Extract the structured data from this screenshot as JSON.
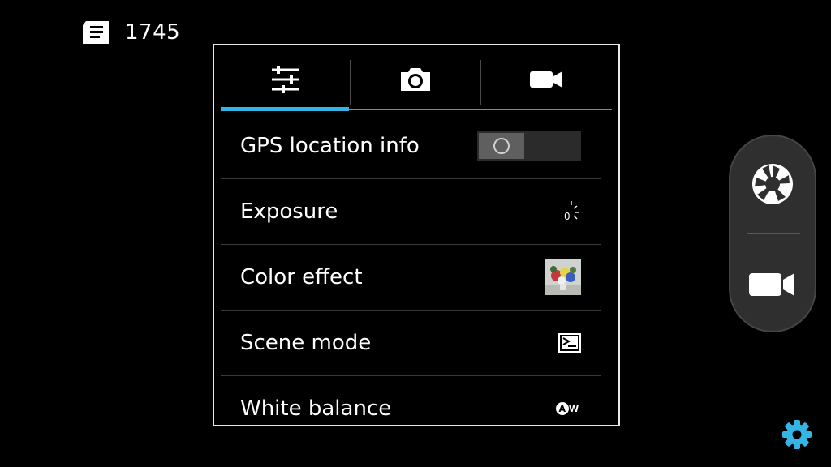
{
  "storage": {
    "remaining_count": "1745",
    "icon": "sd-card-icon"
  },
  "tabs": [
    {
      "icon": "sliders-icon",
      "active": true
    },
    {
      "icon": "camera-icon",
      "active": false
    },
    {
      "icon": "video-camera-icon",
      "active": false
    }
  ],
  "settings_rows": [
    {
      "label": "GPS location info",
      "indicator": "toggle-off"
    },
    {
      "label": "Exposure",
      "indicator": "exposure-icon",
      "value": "0"
    },
    {
      "label": "Color effect",
      "indicator": "color-effect-thumbnail"
    },
    {
      "label": "Scene mode",
      "indicator": "scene-mode-icon"
    },
    {
      "label": "White balance",
      "indicator": "auto-white-balance-icon",
      "value": "AW"
    }
  ],
  "controls": {
    "shutter_icon": "shutter-icon",
    "video_icon": "video-record-icon",
    "settings_icon": "gear-icon"
  },
  "colors": {
    "accent": "#33b5e5",
    "panel_border": "#e8e8e8",
    "background": "#000000"
  }
}
